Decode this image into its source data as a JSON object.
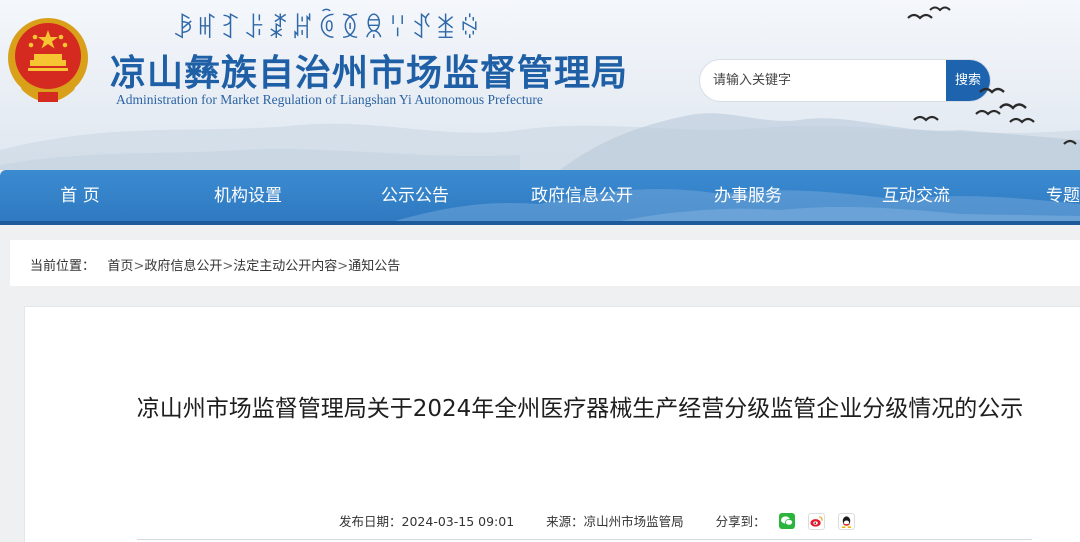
{
  "header": {
    "yi_script": "ꆃꎭꆈꌠꊨꏦꏱꅉꌋꈌꀋꁧꍈ",
    "title": "凉山彝族自治州市场监督管理局",
    "subtitle": "Administration for Market Regulation of Liangshan Yi Autonomous Prefecture",
    "emblem_icon": "national-emblem-icon",
    "search": {
      "placeholder": "请输入关键字",
      "button_label": "搜索"
    }
  },
  "nav": {
    "items": [
      {
        "label": "首 页"
      },
      {
        "label": "机构设置"
      },
      {
        "label": "公示公告"
      },
      {
        "label": "政府信息公开"
      },
      {
        "label": "办事服务"
      },
      {
        "label": "互动交流"
      },
      {
        "label": "专题"
      }
    ]
  },
  "breadcrumb": {
    "prefix": "当前位置：",
    "items": [
      "首页",
      "政府信息公开",
      "法定主动公开内容",
      "通知公告"
    ],
    "separator": ">"
  },
  "article": {
    "title": "凉山州市场监督管理局关于2024年全州医疗器械生产经营分级监管企业分级情况的公示",
    "publish_label": "发布日期：",
    "publish_date": "2024-03-15 09:01",
    "source_label": "来源：",
    "source": "凉山州市场监管局",
    "share_label": "分享到：",
    "share_icons": [
      "wechat-icon",
      "weibo-icon",
      "qq-icon"
    ]
  },
  "colors": {
    "brand_blue": "#1f5fa6",
    "nav_blue": "#3b8bd1",
    "search_button": "#1d63ad"
  }
}
